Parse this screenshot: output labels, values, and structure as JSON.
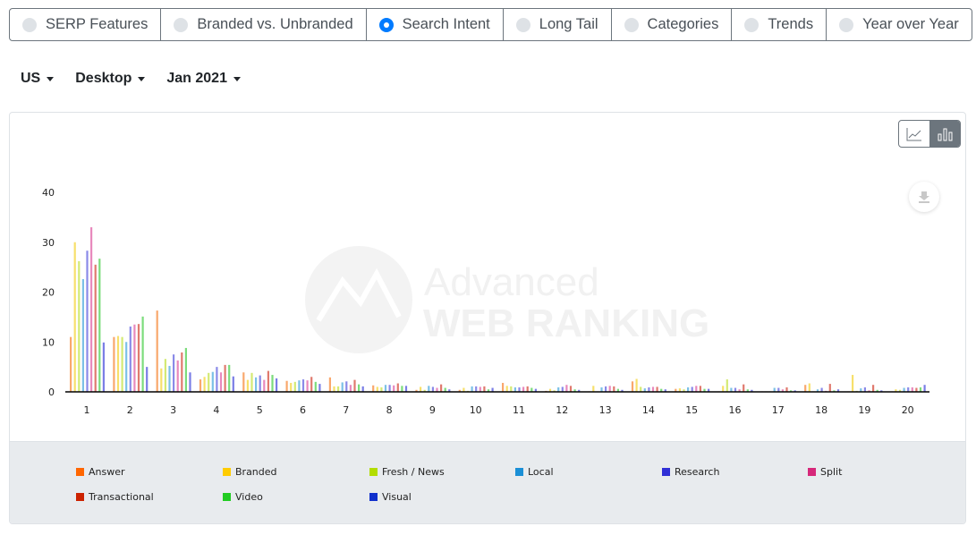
{
  "tabs": [
    {
      "label": "SERP Features",
      "selected": false
    },
    {
      "label": "Branded vs. Unbranded",
      "selected": false
    },
    {
      "label": "Search Intent",
      "selected": true
    },
    {
      "label": "Long Tail",
      "selected": false
    },
    {
      "label": "Categories",
      "selected": false
    },
    {
      "label": "Trends",
      "selected": false
    },
    {
      "label": "Year over Year",
      "selected": false
    }
  ],
  "filters": {
    "country": "US",
    "device": "Desktop",
    "date": "Jan 2021"
  },
  "chart_toggle": {
    "options": [
      "line-chart-icon",
      "bar-chart-icon"
    ],
    "selected": "bar-chart-icon"
  },
  "watermark": {
    "line1": "Advanced",
    "line2": "WEB RANKING"
  },
  "chart_data": {
    "type": "bar",
    "title": "",
    "xlabel": "",
    "ylabel": "",
    "ylim": [
      0,
      40
    ],
    "yticks": [
      0,
      10,
      20,
      30,
      40
    ],
    "grid": false,
    "legend_position": "bottom",
    "categories": [
      "1",
      "2",
      "3",
      "4",
      "5",
      "6",
      "7",
      "8",
      "9",
      "10",
      "11",
      "12",
      "13",
      "14",
      "15",
      "16",
      "17",
      "18",
      "19",
      "20"
    ],
    "series": [
      {
        "name": "Answer",
        "color": "#ff6600",
        "values": [
          11,
          11,
          16.3,
          2.5,
          3.9,
          2.2,
          2.9,
          1.3,
          0.4,
          0.4,
          1.8,
          0.2,
          0.1,
          2.1,
          0.6,
          0.1,
          0.1,
          1.4,
          0.1,
          0.1
        ]
      },
      {
        "name": "Branded",
        "color": "#ffcc00",
        "values": [
          30,
          11.2,
          4.7,
          3,
          2.4,
          1.8,
          1.1,
          1.0,
          1.0,
          0.8,
          1.2,
          0.6,
          1.2,
          2.6,
          0.7,
          1.2,
          0.1,
          1.7,
          3.4,
          0.5
        ]
      },
      {
        "name": "Fresh / News",
        "color": "#b3dd00",
        "values": [
          26.2,
          11,
          6.6,
          3.8,
          3.8,
          2.0,
          1.1,
          0.9,
          0.4,
          0.2,
          1.1,
          0.3,
          0.1,
          1.0,
          0.5,
          2.5,
          0.1,
          0.1,
          0.2,
          0.4
        ]
      },
      {
        "name": "Local",
        "color": "#1a8fd6",
        "values": [
          22.6,
          10,
          5.2,
          4,
          2.9,
          2.3,
          1.9,
          1.4,
          1.2,
          1.1,
          0.9,
          0.9,
          0.9,
          0.7,
          0.9,
          0.8,
          0.8,
          0.5,
          0.7,
          0.8
        ]
      },
      {
        "name": "Research",
        "color": "#3030d6",
        "values": [
          28.3,
          13.1,
          7.5,
          5,
          3.3,
          2.5,
          2.1,
          1.4,
          1.0,
          1.1,
          0.9,
          1.0,
          1.1,
          0.9,
          1.0,
          0.8,
          0.8,
          0.8,
          0.9,
          0.9
        ]
      },
      {
        "name": "Split",
        "color": "#d6287a",
        "values": [
          33,
          13.5,
          6.3,
          3.9,
          2.4,
          2.3,
          1.4,
          1.3,
          0.8,
          1.0,
          1.0,
          1.4,
          1.2,
          1.0,
          1.2,
          0.5,
          0.5,
          0.2,
          0.3,
          0.9
        ]
      },
      {
        "name": "Transactional",
        "color": "#cc2200",
        "values": [
          25.5,
          13.6,
          7.9,
          5.4,
          4.2,
          3.0,
          2.4,
          1.7,
          1.5,
          1.1,
          1.1,
          1.2,
          1.1,
          1.0,
          1.2,
          1.5,
          0.9,
          1.6,
          1.4,
          0.8
        ]
      },
      {
        "name": "Video",
        "color": "#22cc22",
        "values": [
          26.7,
          15.1,
          8.8,
          5.4,
          3.4,
          2.0,
          1.5,
          1.2,
          0.8,
          0.5,
          0.8,
          0.5,
          0.6,
          0.6,
          0.6,
          0.5,
          0.3,
          0.3,
          0.4,
          0.9
        ]
      },
      {
        "name": "Visual",
        "color": "#1030cc",
        "values": [
          9.9,
          5,
          3.9,
          3.1,
          2.7,
          1.6,
          1.1,
          1.2,
          0.5,
          0.8,
          0.6,
          0.4,
          0.4,
          0.5,
          0.6,
          0.4,
          0.3,
          0.5,
          0.3,
          1.4
        ]
      }
    ]
  }
}
